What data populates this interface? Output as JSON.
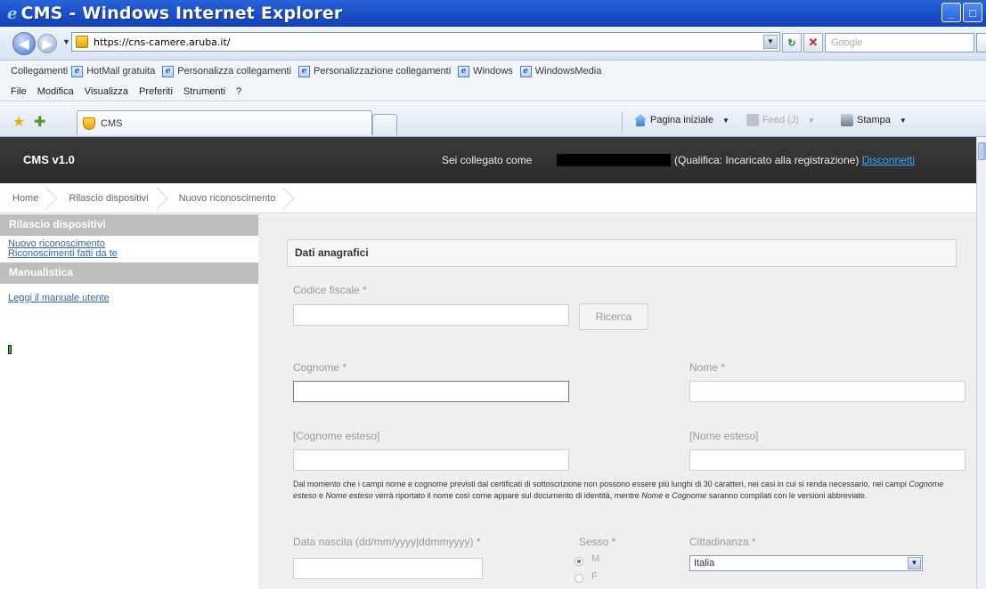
{
  "window": {
    "title": "CMS - Windows Internet Explorer",
    "ie_glyph": "e"
  },
  "browser": {
    "url": "https://cns-camere.aruba.it/",
    "search_placeholder": "Google",
    "links_label": "Collegamenti",
    "links": [
      "HotMail gratuita",
      "Personalizza collegamenti",
      "Personalizzazione collegamenti",
      "Windows",
      "WindowsMedia"
    ],
    "menu": [
      "File",
      "Modifica",
      "Visualizza",
      "Preferiti",
      "Strumenti",
      "?"
    ],
    "tab_title": "CMS",
    "commands": {
      "home": "Pagina iniziale",
      "feed": "Feed (J)",
      "print": "Stampa"
    }
  },
  "header": {
    "brand": "CMS v1.0",
    "logged_as": "Sei collegato come",
    "qualification": "(Qualifica: Incaricato alla registrazione)",
    "logout": "Disconnetti"
  },
  "breadcrumb": [
    "Home",
    "Rilascio dispositivi",
    "Nuovo riconoscimento"
  ],
  "sidebar": {
    "sections": [
      {
        "title": "Rilascio dispositivi",
        "items": [
          "Nuovo riconoscimento",
          "Riconoscimenti fatti da te"
        ]
      },
      {
        "title": "Manualistica",
        "items": [
          "Leggi il manuale utente"
        ]
      }
    ]
  },
  "form": {
    "panel_title": "Dati anagrafici",
    "codice_fiscale_label": "Codice fiscale *",
    "search_button": "Ricerca",
    "cognome_label": "Cognome *",
    "nome_label": "Nome *",
    "cognome_esteso_label": "[Cognome esteso]",
    "nome_esteso_label": "[Nome esteso]",
    "note_part1": "Dal momento che i campi nome e cognome previsti dal certificati di sottoscrizione non possono essere più lunghi di 30 caratteri, nei casi in cui si renda necessario, nei campi ",
    "note_italic1": "Cognome esteso",
    "note_part2": " e ",
    "note_italic2": "Nome esteso",
    "note_part3": " verrà riportato il nome così come appare sul documento di identità, mentre ",
    "note_italic3": "Nome",
    "note_part4": " e ",
    "note_italic4": "Cognome",
    "note_part5": " saranno compilati con le versioni abbreviate.",
    "data_nascita_label": "Data nascita (dd/mm/yyyy|ddmmyyyy) *",
    "sesso_label": "Sesso *",
    "sesso_options": [
      "M",
      "F"
    ],
    "sesso_selected": "M",
    "cittadinanza_label": "Cittadinanza *",
    "cittadinanza_value": "Italia"
  }
}
